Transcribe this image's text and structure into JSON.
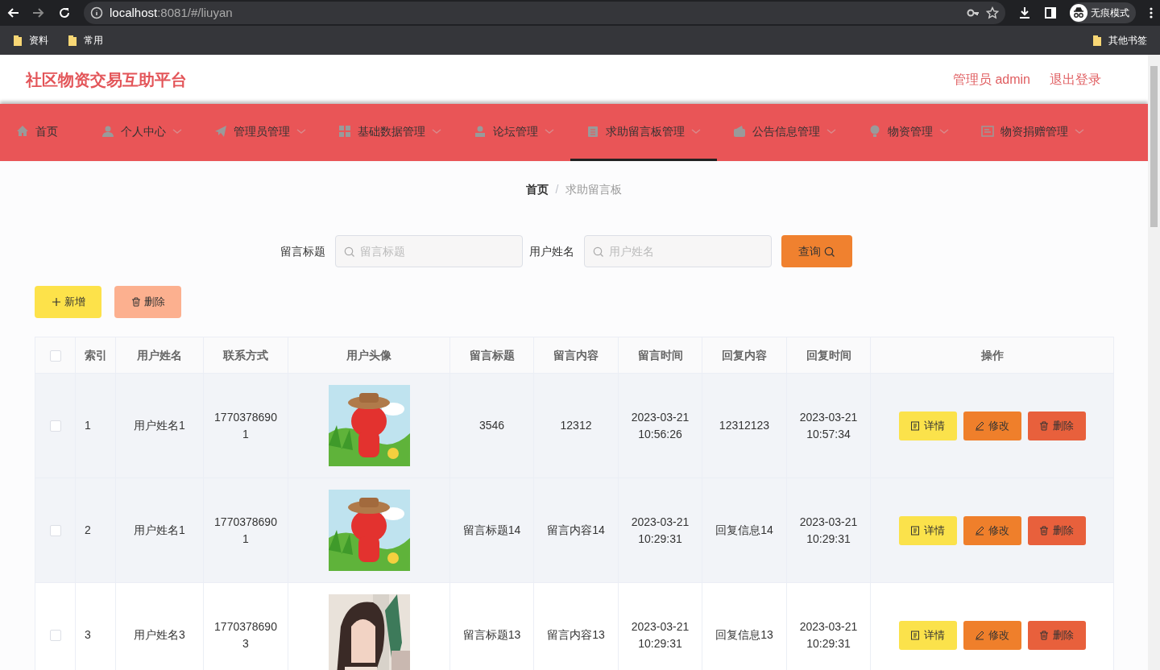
{
  "browser": {
    "url_host": "localhost",
    "url_rest": ":8081/#/liuyan",
    "profile_label": "无痕模式",
    "bookmarks": [
      {
        "label": "资料"
      },
      {
        "label": "常用"
      }
    ],
    "other_bookmarks": "其他书签"
  },
  "header": {
    "title": "社区物资交易互助平台",
    "user": "管理员 admin",
    "logout": "退出登录"
  },
  "nav": [
    {
      "label": "首页",
      "has_menu": false,
      "selected": false
    },
    {
      "label": "个人中心",
      "has_menu": true,
      "selected": false
    },
    {
      "label": "管理员管理",
      "has_menu": true,
      "selected": false
    },
    {
      "label": "基础数据管理",
      "has_menu": true,
      "selected": false
    },
    {
      "label": "论坛管理",
      "has_menu": true,
      "selected": false
    },
    {
      "label": "求助留言板管理",
      "has_menu": true,
      "selected": true
    },
    {
      "label": "公告信息管理",
      "has_menu": true,
      "selected": false
    },
    {
      "label": "物资管理",
      "has_menu": true,
      "selected": false
    },
    {
      "label": "物资捐赠管理",
      "has_menu": true,
      "selected": false
    }
  ],
  "breadcrumb": {
    "items": [
      "首页",
      "求助留言板"
    ],
    "separator": "/"
  },
  "search": {
    "fields": [
      {
        "label": "留言标题",
        "placeholder": "留言标题"
      },
      {
        "label": "用户姓名",
        "placeholder": "用户姓名"
      }
    ],
    "button": "查询"
  },
  "actions": [
    {
      "label": "新增",
      "kind": "add"
    },
    {
      "label": "删除",
      "kind": "delete"
    }
  ],
  "table": {
    "select_all_checked": false,
    "columns": [
      "索引",
      "用户姓名",
      "联系方式",
      "用户头像",
      "留言标题",
      "留言内容",
      "留言时间",
      "回复内容",
      "回复时间",
      "操作"
    ],
    "rows": [
      {
        "checked": false,
        "highlighted": true,
        "index": "1",
        "name": "用户姓名1",
        "phone": "17703786901",
        "title": "3546",
        "content": "12312",
        "time": "2023-03-21 10:56:26",
        "reply": "12312123",
        "reply_time": "2023-03-21 10:57:34",
        "actions": [
          {
            "label": "详情",
            "kind": "detail"
          },
          {
            "label": "修改",
            "kind": "edit"
          },
          {
            "label": "删除",
            "kind": "delete"
          }
        ]
      },
      {
        "checked": false,
        "highlighted": true,
        "index": "2",
        "name": "用户姓名1",
        "phone": "17703786901",
        "title": "留言标题14",
        "content": "留言内容14",
        "time": "2023-03-21 10:29:31",
        "reply": "回复信息14",
        "reply_time": "2023-03-21 10:29:31",
        "actions": [
          {
            "label": "详情",
            "kind": "detail"
          },
          {
            "label": "修改",
            "kind": "edit"
          },
          {
            "label": "删除",
            "kind": "delete"
          }
        ]
      },
      {
        "checked": false,
        "highlighted": false,
        "index": "3",
        "name": "用户姓名3",
        "phone": "17703786903",
        "title": "留言标题13",
        "content": "留言内容13",
        "time": "2023-03-21 10:29:31",
        "reply": "回复信息13",
        "reply_time": "2023-03-21 10:29:31",
        "actions": [
          {
            "label": "详情",
            "kind": "detail"
          },
          {
            "label": "修改",
            "kind": "edit"
          },
          {
            "label": "删除",
            "kind": "delete"
          }
        ]
      }
    ]
  }
}
